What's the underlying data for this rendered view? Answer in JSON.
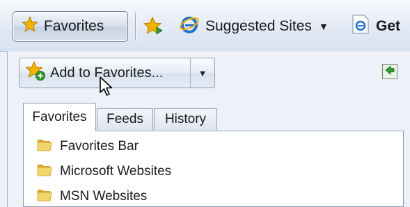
{
  "toolbar": {
    "favorites_label": "Favorites",
    "suggested_label": "Suggested Sites",
    "get_label": "Get"
  },
  "panel": {
    "add_label": "Add to Favorites...",
    "tabs": [
      "Favorites",
      "Feeds",
      "History"
    ],
    "items": [
      "Favorites Bar",
      "Microsoft Websites",
      "MSN Websites"
    ]
  },
  "colors": {
    "star_gold": "#f5b400",
    "folder_yellow": "#e8c24a",
    "ie_blue": "#1f6fd1",
    "pin_green": "#2f9a2f"
  }
}
